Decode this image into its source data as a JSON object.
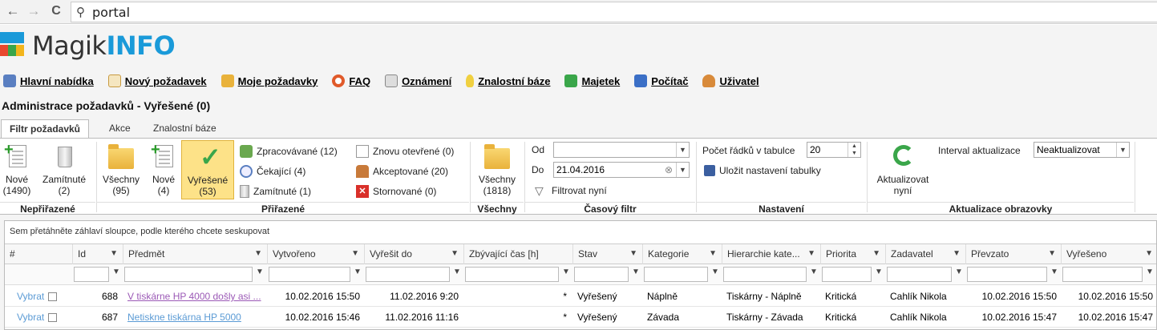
{
  "browser": {
    "url": "portal",
    "back": "←",
    "forward": "→",
    "reload": "C"
  },
  "logo": {
    "part1": "Magik",
    "part2": "INFO",
    "colors": [
      "#1a9ad9",
      "#e8482e",
      "#3aa64a",
      "#f2b51c"
    ]
  },
  "menu": [
    {
      "label": "Hlavní nabídka",
      "icon": "home-icon",
      "color": "#5a7fc1"
    },
    {
      "label": "Nový požadavek",
      "icon": "new-request-icon",
      "color": "#d0a040"
    },
    {
      "label": "Moje požadavky",
      "icon": "folder-icon",
      "color": "#e9b23b"
    },
    {
      "label": "FAQ",
      "icon": "lifebuoy-icon",
      "color": "#e05a2a"
    },
    {
      "label": "Oznámení",
      "icon": "announcement-icon",
      "color": "#8a8a8a"
    },
    {
      "label": "Znalostní báze",
      "icon": "lightbulb-icon",
      "color": "#f0d040"
    },
    {
      "label": "Majetek",
      "icon": "money-icon",
      "color": "#3aa64a"
    },
    {
      "label": "Počítač",
      "icon": "computer-icon",
      "color": "#3b6fc6"
    },
    {
      "label": "Uživatel",
      "icon": "user-icon",
      "color": "#d88a3a"
    }
  ],
  "page_title": "Administrace požadavků - Vyřešené (0)",
  "tabs": [
    "Filtr požadavků",
    "Akce",
    "Znalostní báze"
  ],
  "ribbon": {
    "nepriazene": {
      "label": "Nepřiřazené",
      "nove": {
        "line1": "Nové",
        "line2": "(1490)"
      },
      "zamitnute": {
        "line1": "Zamítnuté",
        "line2": "(2)"
      }
    },
    "prirazene": {
      "label": "Přiřazené",
      "vsechny": {
        "line1": "Všechny",
        "line2": "(95)"
      },
      "nove": {
        "line1": "Nové",
        "line2": "(4)"
      },
      "vyresene": {
        "line1": "Vyřešené",
        "line2": "(53)"
      },
      "zpracovavane": "Zpracovávané (12)",
      "cekajici": "Čekající (4)",
      "zamitnute": "Zamítnuté (1)",
      "znovu": "Znovu otevřené (0)",
      "akceptovane": "Akceptované (20)",
      "stornovane": "Stornované (0)"
    },
    "vsechny": {
      "label": "Všechny",
      "btn": {
        "line1": "Všechny",
        "line2": "(1818)"
      }
    },
    "casovy": {
      "label": "Časový filtr",
      "od": "Od",
      "do": "Do",
      "od_value": "",
      "do_value": "21.04.2016",
      "filtrovat": "Filtrovat nyní"
    },
    "nastaveni": {
      "label": "Nastavení",
      "pocet_label": "Počet řádků v tabulce",
      "pocet_value": "20",
      "ulozit": "Uložit nastavení tabulky"
    },
    "aktualizace": {
      "label": "Aktualizace obrazovky",
      "btn_line1": "Aktualizovat",
      "btn_line2": "nyní",
      "interval_label": "Interval aktualizace",
      "interval_value": "Neaktualizovat"
    }
  },
  "grid": {
    "group_hint": "Sem přetáhněte záhlaví sloupce, podle kterého chcete seskupovat",
    "columns": [
      "#",
      "Id",
      "Předmět",
      "Vytvořeno",
      "Vyřešit do",
      "Zbývající čas [h]",
      "Stav",
      "Kategorie",
      "Hierarchie kate...",
      "Priorita",
      "Zadavatel",
      "Převzato",
      "Vyřešeno"
    ],
    "rows": [
      {
        "action": "Vybrat",
        "id": "688",
        "subject": "V tiskárne HP 4000 došly asi ...",
        "created": "10.02.2016 15:50",
        "due": "11.02.2016 9:20",
        "remaining": "*",
        "state": "Vyřešený",
        "category": "Náplně",
        "hierarchy": "Tiskárny - Náplně",
        "priority": "Kritická",
        "requester": "Cahlík Nikola",
        "taken": "10.02.2016 15:50",
        "resolved": "10.02.2016 15:50"
      },
      {
        "action": "Vybrat",
        "id": "687",
        "subject": "Netiskne tiskárna HP 5000",
        "created": "10.02.2016 15:46",
        "due": "11.02.2016 11:16",
        "remaining": "*",
        "state": "Vyřešený",
        "category": "Závada",
        "hierarchy": "Tiskárny - Závada",
        "priority": "Kritická",
        "requester": "Cahlík Nikola",
        "taken": "10.02.2016 15:47",
        "resolved": "10.02.2016 15:47"
      }
    ]
  }
}
